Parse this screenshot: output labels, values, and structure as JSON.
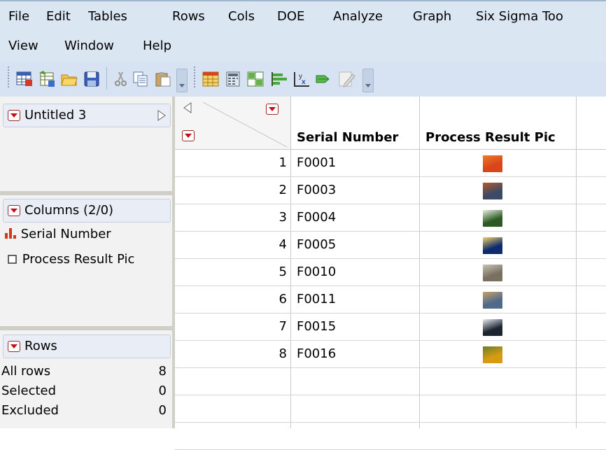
{
  "menu": [
    "File",
    "Edit",
    "Tables",
    "Rows",
    "Cols",
    "DOE",
    "Analyze",
    "Graph",
    "Six Sigma Too",
    "View",
    "Window",
    "Help"
  ],
  "toolbar": {
    "group1": [
      "new-data-table-icon",
      "open-data-table-icon",
      "open-folder-icon",
      "save-icon",
      "cut-icon",
      "copy-icon",
      "paste-icon"
    ],
    "group2": [
      "data-grid-icon",
      "calculator-icon",
      "table-layout-icon",
      "bar-chart-icon",
      "formula-icon",
      "arrow-icon",
      "edit-script-icon"
    ]
  },
  "table_panel": {
    "title": "Untitled 3"
  },
  "columns_panel": {
    "title": "Columns (2/0)",
    "items": [
      {
        "label": "Serial Number",
        "icon": "nominal-bars-icon"
      },
      {
        "label": "Process Result Pic",
        "icon": "expression-box-icon"
      }
    ]
  },
  "rows_panel": {
    "title": "Rows",
    "stats": [
      {
        "label": "All rows",
        "value": "8"
      },
      {
        "label": "Selected",
        "value": "0"
      },
      {
        "label": "Excluded",
        "value": "0"
      }
    ]
  },
  "grid": {
    "columns": [
      "Serial Number",
      "Process Result Pic"
    ],
    "rows": [
      {
        "n": "1",
        "serial": "F0001",
        "pic_colors": [
          "#d8461a",
          "#f07a2a"
        ]
      },
      {
        "n": "2",
        "serial": "F0003",
        "pic_colors": [
          "#3b4a66",
          "#b55a2a"
        ]
      },
      {
        "n": "3",
        "serial": "F0004",
        "pic_colors": [
          "#2d5a24",
          "#e8efe0"
        ]
      },
      {
        "n": "4",
        "serial": "F0005",
        "pic_colors": [
          "#0d2b6e",
          "#f2d36a"
        ]
      },
      {
        "n": "5",
        "serial": "F0010",
        "pic_colors": [
          "#7a7060",
          "#c9c3b6"
        ]
      },
      {
        "n": "6",
        "serial": "F0011",
        "pic_colors": [
          "#506a8a",
          "#c7a16a"
        ]
      },
      {
        "n": "7",
        "serial": "F0015",
        "pic_colors": [
          "#1c2430",
          "#e9edf2"
        ]
      },
      {
        "n": "8",
        "serial": "F0016",
        "pic_colors": [
          "#d79b12",
          "#6a7e2a"
        ]
      }
    ]
  },
  "colors": {
    "menubar": "#dbe6f3",
    "accent_red": "#c0101a"
  }
}
